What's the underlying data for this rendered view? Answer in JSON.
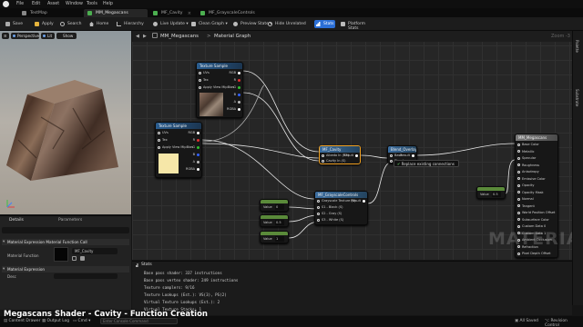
{
  "menu": {
    "items": [
      "File",
      "Edit",
      "Asset",
      "Window",
      "Tools",
      "Help"
    ]
  },
  "tabs": [
    {
      "label": "TestMap"
    },
    {
      "label": "MM_Megascans"
    },
    {
      "label": "MF_Cavity"
    },
    {
      "label": "MF_GrayscaleControls"
    }
  ],
  "toolbar": {
    "save": "Save",
    "apply": "Apply",
    "search": "Search",
    "home": "Home",
    "hierarchy": "Hierarchy",
    "live_update": "Live Update",
    "clean_graph": "Clean Graph",
    "preview_state": "Preview State",
    "hide_unrelated": "Hide Unrelated",
    "stats": "Stats",
    "platform_stats": "Platform Stats"
  },
  "viewport": {
    "perspective": "Perspective",
    "lit": "Lit",
    "show": "Show"
  },
  "details": {
    "tab_details": "Details",
    "tab_parameters": "Parameters",
    "section1": "Material Expression Material Function Call",
    "material_function_label": "Material Function",
    "material_function_value": "MF_Cavity",
    "section2": "Material Expression",
    "desc_label": "Desc"
  },
  "graph": {
    "breadcrumb_root": "MM_Megascans",
    "breadcrumb_sep": ">",
    "breadcrumb_current": "Material Graph",
    "zoom": "Zoom -3",
    "watermark": "MATERIAL"
  },
  "nodes": {
    "tex1": {
      "title": "Texture Sample",
      "pins": [
        "UVs",
        "Tex",
        "Apply View MipBias"
      ],
      "outputs": [
        "RGB",
        "R",
        "G",
        "B",
        "A",
        "RGBA"
      ]
    },
    "tex2": {
      "title": "Texture Sample",
      "pins": [
        "UVs",
        "Tex",
        "Apply View MipBias"
      ],
      "outputs": [
        "RGB",
        "R",
        "G",
        "B",
        "A",
        "RGBA"
      ]
    },
    "cavity": {
      "title": "MF_Cavity",
      "pins": [
        "Albedo In (V3)",
        "Cavity In (S)"
      ],
      "output": "Result"
    },
    "blend": {
      "title": "Blend_Overlay",
      "pins": [
        "Base",
        "Blend"
      ],
      "output": "Result"
    },
    "tooltip": "Replace existing connections",
    "grayscale": {
      "title": "MF_GrayscaleControls",
      "pins": [
        "Grayscale Texture (S)",
        "S1 - Black (S)",
        "S2 - Gray (S)",
        "S3 - White (S)"
      ],
      "output": "Result"
    },
    "const1": {
      "label": "Value",
      "value": "0"
    },
    "const2": {
      "label": "Value",
      "value": "0.5"
    },
    "const3": {
      "label": "Value",
      "value": "1"
    },
    "const4": {
      "label": "Value",
      "value": "0.5"
    },
    "result": {
      "title": "MM_Megascans",
      "pins": [
        "Base Color",
        "Metallic",
        "Specular",
        "Roughness",
        "Anisotropy",
        "Emissive Color",
        "Opacity",
        "Opacity Mask",
        "Normal",
        "Tangent",
        "World Position Offset",
        "Subsurface Color",
        "Custom Data 0",
        "Custom Data 1",
        "Ambient Occlusion",
        "Refraction",
        "Pixel Depth Offset"
      ]
    }
  },
  "right_strip": {
    "palette": "Palette",
    "substrate": "Substrate"
  },
  "stats": {
    "tab": "Stats",
    "lines": [
      "Base pass shader: 337 instructions",
      "Base pass vertex shader: 249 instructions",
      "Texture samplers: 9/16",
      "Texture Lookups (Est.): VS(3), PS(2)",
      "Virtual Texture Lookups (Est.): 2",
      "Virtual Texture Stacks: 1"
    ]
  },
  "statusbar": {
    "content_drawer": "Content Drawer",
    "output_log": "Output Log",
    "cmd": "Cmd",
    "cmd_placeholder": "Enter Console Command",
    "all_saved": "All Saved",
    "revision_control": "Revision Control"
  },
  "caption": "Megascans Shader - Cavity - Function Creation"
}
